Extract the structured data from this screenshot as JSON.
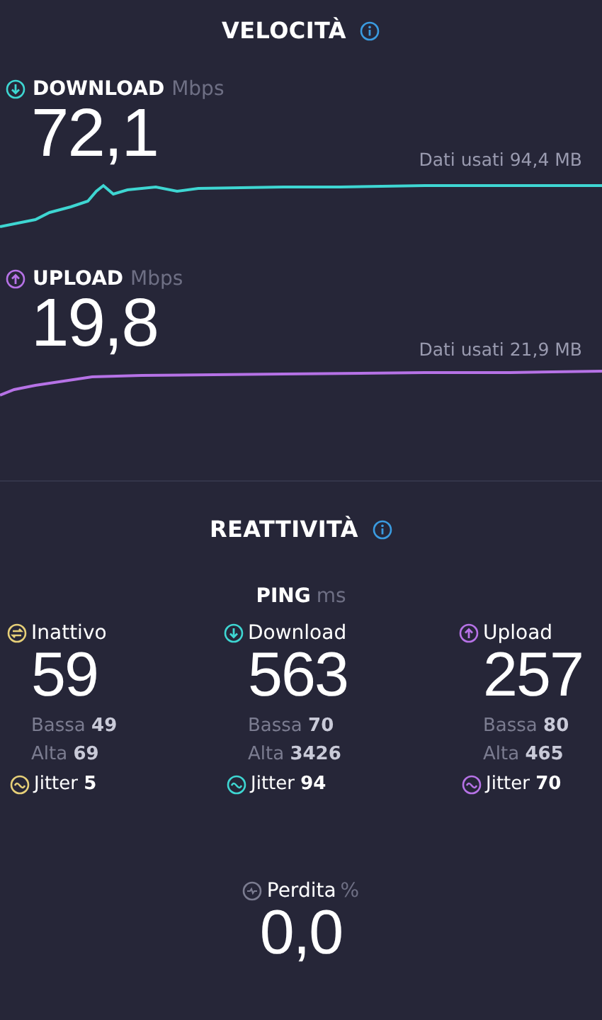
{
  "speed_section": {
    "title": "VELOCITÀ"
  },
  "speed": [
    {
      "kind": "download",
      "label": "DOWNLOAD",
      "unit": "Mbps",
      "value": "72,1",
      "data_used": "Dati usati 94,4 MB",
      "color": "#3ed6d2"
    },
    {
      "kind": "upload",
      "label": "UPLOAD",
      "unit": "Mbps",
      "value": "19,8",
      "data_used": "Dati usati 21,9 MB",
      "color": "#b672e6"
    }
  ],
  "responsiveness": {
    "title": "REATTIVITÀ",
    "ping_label": "PING",
    "ping_unit": "ms",
    "columns": [
      {
        "kind": "idle",
        "label": "Inattivo",
        "value": "59",
        "low": "Bassa **49**",
        "high": "Alta **69**",
        "jitter": "Jitter **5**",
        "color": "#e6cf78"
      },
      {
        "kind": "download",
        "label": "Download",
        "value": "563",
        "low": "Bassa **70**",
        "high": "Alta **3426**",
        "jitter": "Jitter **94**",
        "color": "#3ed6d2"
      },
      {
        "kind": "upload",
        "label": "Upload",
        "value": "257",
        "low": "Bassa **80**",
        "high": "Alta **465**",
        "jitter": "Jitter **70**",
        "color": "#b672e6"
      }
    ]
  },
  "loss": {
    "label": "Perdita",
    "unit": "%",
    "value": "0,0"
  }
}
